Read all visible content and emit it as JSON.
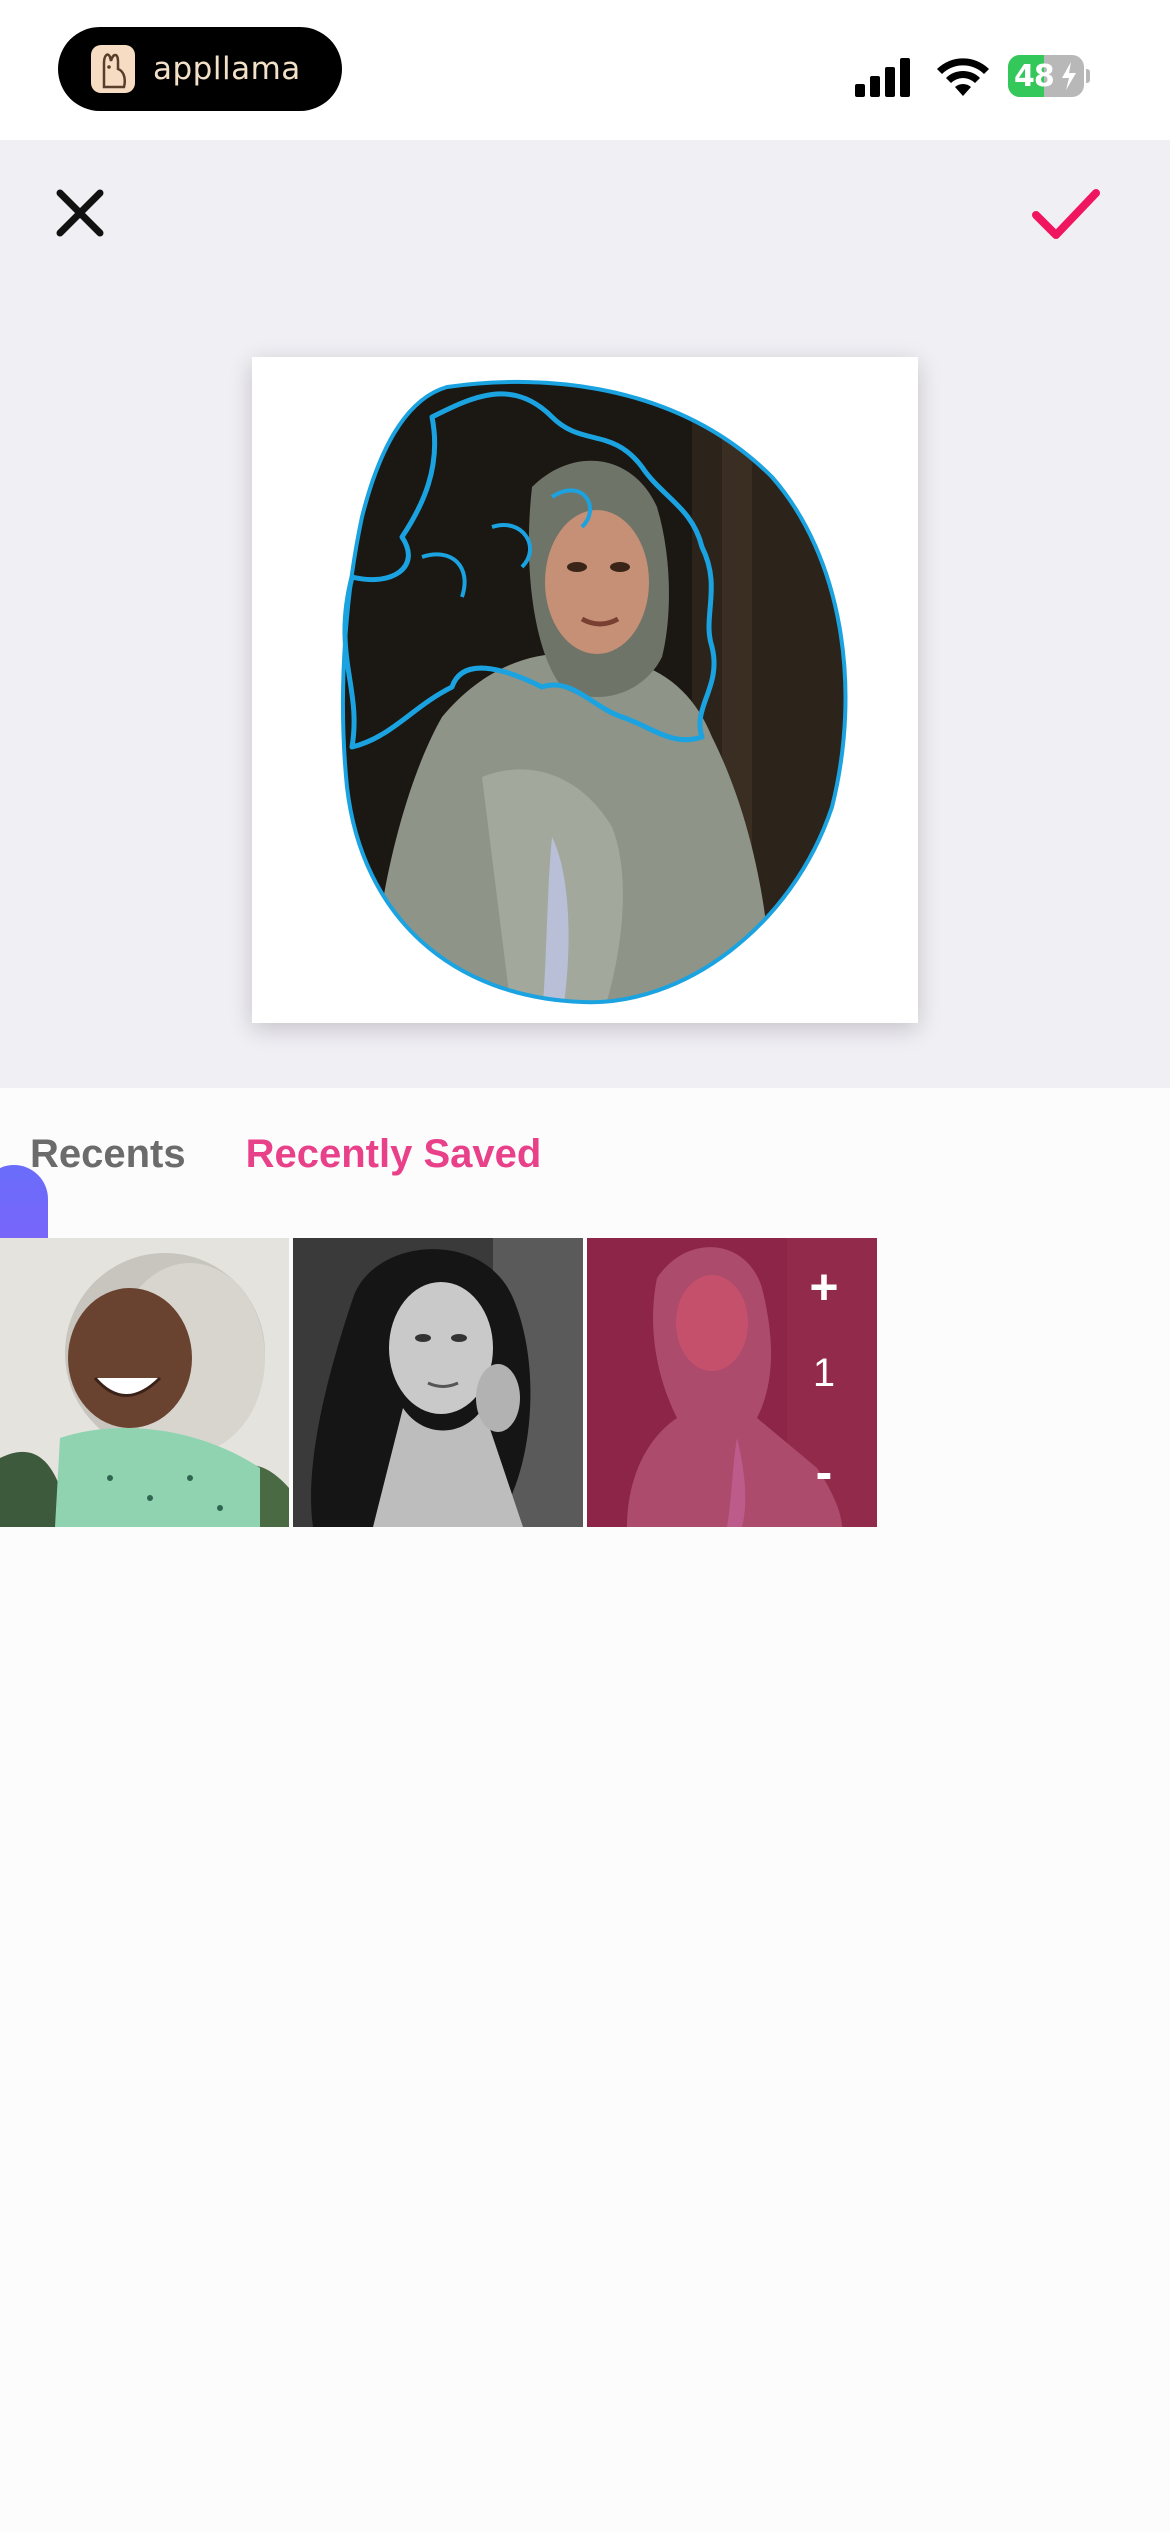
{
  "status_bar": {
    "app_name": "appllama",
    "battery_level": "48",
    "battery_fraction": 0.48,
    "battery_color": "#34c759",
    "icons": [
      "signal-icon",
      "wifi-icon",
      "battery-charging-icon"
    ]
  },
  "editor": {
    "close_icon": "close-icon",
    "confirm_icon": "checkmark-icon",
    "accent_color": "#f0155f",
    "outline_color": "#1aa3e0"
  },
  "tabs": [
    {
      "label": "Recents",
      "active": false
    },
    {
      "label": "Recently Saved",
      "active": true
    }
  ],
  "thumbnails": [
    {
      "description": "smiling woman with gray hair",
      "selected": false
    },
    {
      "description": "woman with curly hair, black and white",
      "selected": false
    },
    {
      "description": "woman in headscarf",
      "selected": true,
      "quantity": "1",
      "plus_label": "+",
      "minus_label": "-"
    }
  ]
}
